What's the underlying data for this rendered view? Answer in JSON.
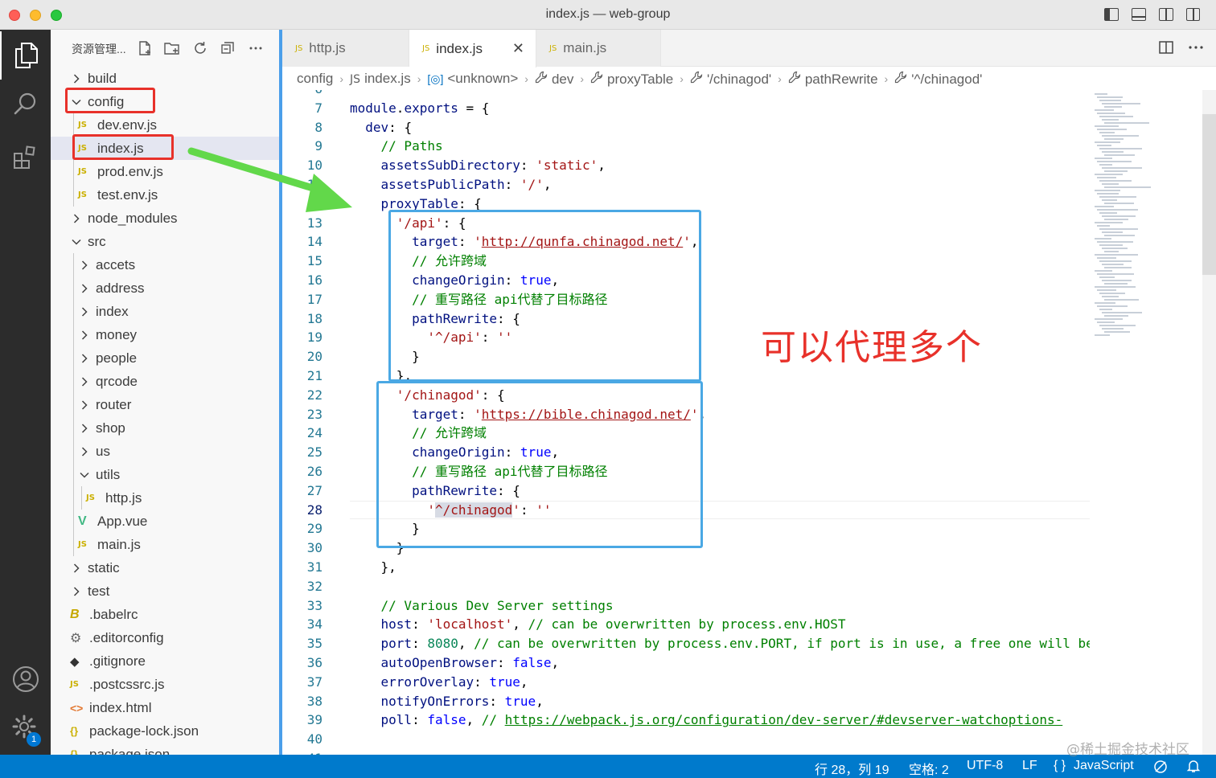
{
  "window": {
    "title": "index.js — web-group"
  },
  "activity": {
    "badge_count": "1"
  },
  "sidebar": {
    "title": "资源管理...",
    "tree": [
      {
        "label": "build",
        "type": "folder",
        "expanded": false,
        "depth": 0
      },
      {
        "label": "config",
        "type": "folder",
        "expanded": true,
        "depth": 0
      },
      {
        "label": "dev.env.js",
        "type": "js",
        "depth": 1
      },
      {
        "label": "index.js",
        "type": "js",
        "depth": 1
      },
      {
        "label": "prod.env.js",
        "type": "js",
        "depth": 1
      },
      {
        "label": "test.env.js",
        "type": "js",
        "depth": 1
      },
      {
        "label": "node_modules",
        "type": "folder",
        "expanded": false,
        "depth": 0
      },
      {
        "label": "src",
        "type": "folder",
        "expanded": true,
        "depth": 0
      },
      {
        "label": "accets",
        "type": "folder",
        "expanded": false,
        "depth": 1
      },
      {
        "label": "address",
        "type": "folder",
        "expanded": false,
        "depth": 1
      },
      {
        "label": "index",
        "type": "folder",
        "expanded": false,
        "depth": 1
      },
      {
        "label": "money",
        "type": "folder",
        "expanded": false,
        "depth": 1
      },
      {
        "label": "people",
        "type": "folder",
        "expanded": false,
        "depth": 1
      },
      {
        "label": "qrcode",
        "type": "folder",
        "expanded": false,
        "depth": 1
      },
      {
        "label": "router",
        "type": "folder",
        "expanded": false,
        "depth": 1
      },
      {
        "label": "shop",
        "type": "folder",
        "expanded": false,
        "depth": 1
      },
      {
        "label": "us",
        "type": "folder",
        "expanded": false,
        "depth": 1
      },
      {
        "label": "utils",
        "type": "folder",
        "expanded": true,
        "depth": 1
      },
      {
        "label": "http.js",
        "type": "js",
        "depth": 2
      },
      {
        "label": "App.vue",
        "type": "vue",
        "depth": 1
      },
      {
        "label": "main.js",
        "type": "js",
        "depth": 1
      },
      {
        "label": "static",
        "type": "folder",
        "expanded": false,
        "depth": 0
      },
      {
        "label": "test",
        "type": "folder",
        "expanded": false,
        "depth": 0
      },
      {
        "label": ".babelrc",
        "type": "babel",
        "depth": 0
      },
      {
        "label": ".editorconfig",
        "type": "gear",
        "depth": 0
      },
      {
        "label": ".gitignore",
        "type": "git",
        "depth": 0
      },
      {
        "label": ".postcssrc.js",
        "type": "js",
        "depth": 0
      },
      {
        "label": "index.html",
        "type": "html",
        "depth": 0
      },
      {
        "label": "package-lock.json",
        "type": "json",
        "depth": 0
      },
      {
        "label": "package.json",
        "type": "json",
        "depth": 0
      }
    ]
  },
  "tabs": [
    {
      "label": "http.js",
      "active": false
    },
    {
      "label": "index.js",
      "active": true
    },
    {
      "label": "main.js",
      "active": false
    }
  ],
  "breadcrumb": [
    "config",
    "index.js",
    "<unknown>",
    "dev",
    "proxyTable",
    "'/chinagod'",
    "pathRewrite",
    "'^/chinagod'"
  ],
  "editor": {
    "current_line": 28,
    "lines": [
      {
        "n": "6",
        "tokens": []
      },
      {
        "n": "7",
        "tokens": [
          [
            "p",
            "module"
          ],
          [
            "t",
            "."
          ],
          [
            "p",
            "exports"
          ],
          [
            "t",
            " = {"
          ]
        ]
      },
      {
        "n": "8",
        "tokens": [
          [
            "t",
            "  "
          ],
          [
            "p",
            "dev"
          ],
          [
            "t",
            ": {"
          ]
        ]
      },
      {
        "n": "9",
        "tokens": [
          [
            "t",
            "    "
          ],
          [
            "c",
            "// Paths"
          ]
        ]
      },
      {
        "n": "10",
        "tokens": [
          [
            "t",
            "    "
          ],
          [
            "p",
            "assetsSubDirectory"
          ],
          [
            "t",
            ": "
          ],
          [
            "s",
            "'static'"
          ],
          [
            "t",
            ","
          ]
        ]
      },
      {
        "n": "11",
        "tokens": [
          [
            "t",
            "    "
          ],
          [
            "p",
            "assetsPublicPath"
          ],
          [
            "t",
            ": "
          ],
          [
            "s",
            "'/'"
          ],
          [
            "t",
            ","
          ]
        ]
      },
      {
        "n": "12",
        "tokens": [
          [
            "t",
            "    "
          ],
          [
            "p",
            "proxyTable"
          ],
          [
            "t",
            ": {"
          ]
        ]
      },
      {
        "n": "13",
        "tokens": [
          [
            "t",
            "      "
          ],
          [
            "s",
            "'/api'"
          ],
          [
            "t",
            ": {"
          ]
        ]
      },
      {
        "n": "14",
        "tokens": [
          [
            "t",
            "        "
          ],
          [
            "p",
            "target"
          ],
          [
            "t",
            ": "
          ],
          [
            "s",
            "'"
          ],
          [
            "su",
            "http://qunfa.chinagod.net/"
          ],
          [
            "s",
            "'"
          ],
          [
            "t",
            ","
          ]
        ]
      },
      {
        "n": "15",
        "tokens": [
          [
            "t",
            "        "
          ],
          [
            "c",
            "// 允许跨域"
          ]
        ]
      },
      {
        "n": "16",
        "tokens": [
          [
            "t",
            "        "
          ],
          [
            "p",
            "changeOrigin"
          ],
          [
            "t",
            ": "
          ],
          [
            "k",
            "true"
          ],
          [
            "t",
            ","
          ]
        ]
      },
      {
        "n": "17",
        "tokens": [
          [
            "t",
            "        "
          ],
          [
            "c",
            "// 重写路径 api代替了目标路径"
          ]
        ]
      },
      {
        "n": "18",
        "tokens": [
          [
            "t",
            "        "
          ],
          [
            "p",
            "pathRewrite"
          ],
          [
            "t",
            ": {"
          ]
        ]
      },
      {
        "n": "19",
        "tokens": [
          [
            "t",
            "          "
          ],
          [
            "s",
            "'^/api'"
          ],
          [
            "t",
            ": "
          ],
          [
            "s",
            "''"
          ]
        ]
      },
      {
        "n": "20",
        "tokens": [
          [
            "t",
            "        }"
          ]
        ]
      },
      {
        "n": "21",
        "tokens": [
          [
            "t",
            "      },"
          ]
        ]
      },
      {
        "n": "22",
        "tokens": [
          [
            "t",
            "      "
          ],
          [
            "s",
            "'/chinagod'"
          ],
          [
            "t",
            ": {"
          ]
        ]
      },
      {
        "n": "23",
        "tokens": [
          [
            "t",
            "        "
          ],
          [
            "p",
            "target"
          ],
          [
            "t",
            ": "
          ],
          [
            "s",
            "'"
          ],
          [
            "su",
            "https://bible.chinagod.net/"
          ],
          [
            "s",
            "'"
          ],
          [
            "t",
            ","
          ]
        ]
      },
      {
        "n": "24",
        "tokens": [
          [
            "t",
            "        "
          ],
          [
            "c",
            "// 允许跨域"
          ]
        ]
      },
      {
        "n": "25",
        "tokens": [
          [
            "t",
            "        "
          ],
          [
            "p",
            "changeOrigin"
          ],
          [
            "t",
            ": "
          ],
          [
            "k",
            "true"
          ],
          [
            "t",
            ","
          ]
        ]
      },
      {
        "n": "26",
        "tokens": [
          [
            "t",
            "        "
          ],
          [
            "c",
            "// 重写路径 api代替了目标路径"
          ]
        ]
      },
      {
        "n": "27",
        "tokens": [
          [
            "t",
            "        "
          ],
          [
            "p",
            "pathRewrite"
          ],
          [
            "t",
            ": {"
          ]
        ]
      },
      {
        "n": "28",
        "tokens": [
          [
            "t",
            "          "
          ],
          [
            "s",
            "'"
          ],
          [
            "sh",
            "^/chinagod"
          ],
          [
            "s",
            "'"
          ],
          [
            "t",
            ": "
          ],
          [
            "s",
            "''"
          ]
        ]
      },
      {
        "n": "29",
        "tokens": [
          [
            "t",
            "        }"
          ]
        ]
      },
      {
        "n": "30",
        "tokens": [
          [
            "t",
            "      }"
          ]
        ]
      },
      {
        "n": "31",
        "tokens": [
          [
            "t",
            "    },"
          ]
        ]
      },
      {
        "n": "32",
        "tokens": []
      },
      {
        "n": "33",
        "tokens": [
          [
            "t",
            "    "
          ],
          [
            "c",
            "// Various Dev Server settings"
          ]
        ]
      },
      {
        "n": "34",
        "tokens": [
          [
            "t",
            "    "
          ],
          [
            "p",
            "host"
          ],
          [
            "t",
            ": "
          ],
          [
            "s",
            "'localhost'"
          ],
          [
            "t",
            ", "
          ],
          [
            "c",
            "// can be overwritten by process.env.HOST"
          ]
        ]
      },
      {
        "n": "35",
        "tokens": [
          [
            "t",
            "    "
          ],
          [
            "p",
            "port"
          ],
          [
            "t",
            ": "
          ],
          [
            "n",
            "8080"
          ],
          [
            "t",
            ", "
          ],
          [
            "c",
            "// can be overwritten by process.env.PORT, if port is in use, a free one will be"
          ]
        ]
      },
      {
        "n": "36",
        "tokens": [
          [
            "t",
            "    "
          ],
          [
            "p",
            "autoOpenBrowser"
          ],
          [
            "t",
            ": "
          ],
          [
            "k",
            "false"
          ],
          [
            "t",
            ","
          ]
        ]
      },
      {
        "n": "37",
        "tokens": [
          [
            "t",
            "    "
          ],
          [
            "p",
            "errorOverlay"
          ],
          [
            "t",
            ": "
          ],
          [
            "k",
            "true"
          ],
          [
            "t",
            ","
          ]
        ]
      },
      {
        "n": "38",
        "tokens": [
          [
            "t",
            "    "
          ],
          [
            "p",
            "notifyOnErrors"
          ],
          [
            "t",
            ": "
          ],
          [
            "k",
            "true"
          ],
          [
            "t",
            ","
          ]
        ]
      },
      {
        "n": "39",
        "tokens": [
          [
            "t",
            "    "
          ],
          [
            "p",
            "poll"
          ],
          [
            "t",
            ": "
          ],
          [
            "k",
            "false"
          ],
          [
            "t",
            ", "
          ],
          [
            "c",
            "// "
          ],
          [
            "cu",
            "https://webpack.js.org/configuration/dev-server/#devserver-watchoptions-"
          ]
        ]
      },
      {
        "n": "40",
        "tokens": []
      },
      {
        "n": "41",
        "tokens": []
      }
    ]
  },
  "annotation": {
    "text": "可以代理多个"
  },
  "watermark": {
    "text": "@稀土掘金技术社区"
  },
  "statusbar": {
    "position": "行 28，列 19",
    "spaces": "空格: 2",
    "encoding": "UTF-8",
    "eol": "LF",
    "language_icon": "{ }",
    "language": "JavaScript"
  },
  "colors": {
    "accent": "#007acc",
    "highlight_red": "#e8312a",
    "highlight_blue": "#4aa8e4",
    "arrow_green": "#62d84a"
  }
}
